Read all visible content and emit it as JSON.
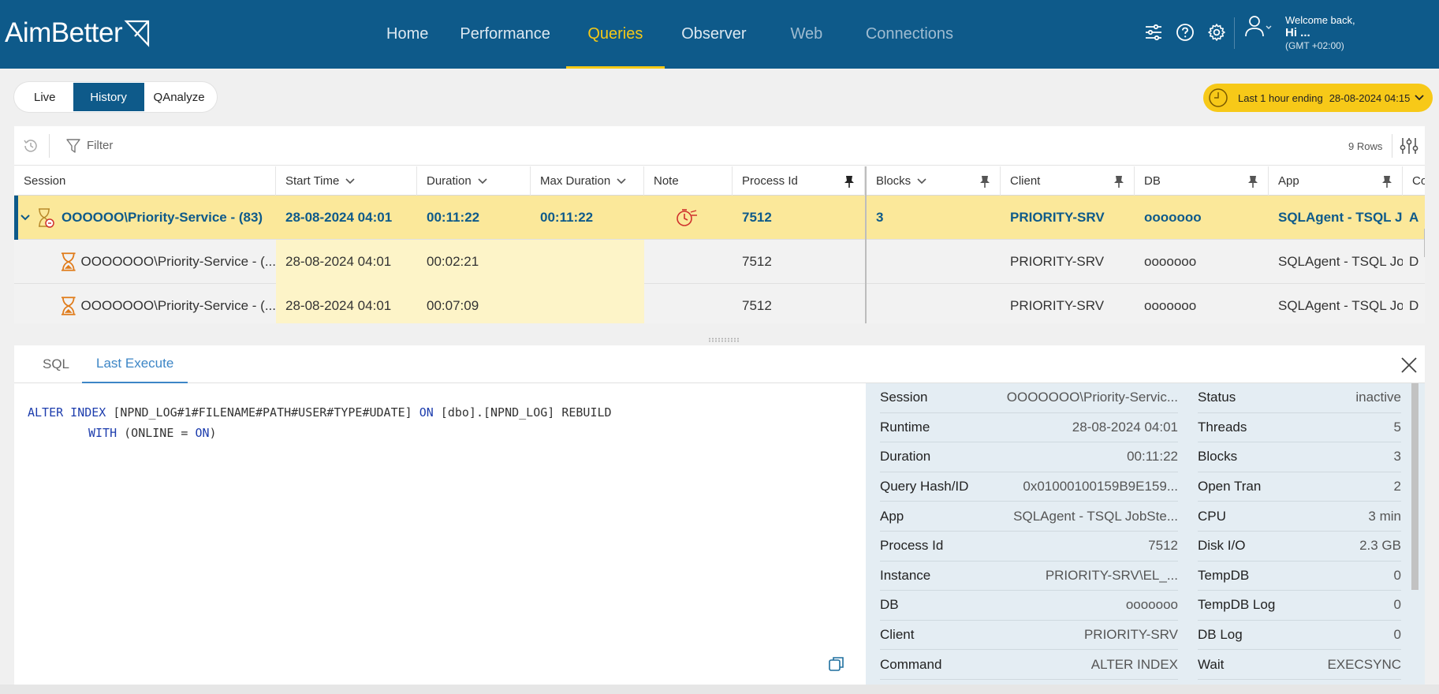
{
  "brand": {
    "name": "AimBetter"
  },
  "nav": [
    "Home",
    "Performance",
    "Queries",
    "Observer",
    "Web",
    "Connections"
  ],
  "user": {
    "welcome": "Welcome back,",
    "greeting": "Hi ...",
    "timezone": "(GMT +02:00)"
  },
  "mode_tabs": [
    "Live",
    "History",
    "QAnalyze"
  ],
  "time_range": {
    "label": "Last 1 hour ending",
    "value": "28-08-2024 04:15"
  },
  "toolbar": {
    "filter": "Filter",
    "rows": "9 Rows"
  },
  "columns": [
    "Session",
    "Start Time",
    "Duration",
    "Max Duration",
    "Note",
    "Process Id",
    "Blocks",
    "Client",
    "DB",
    "App",
    "Con"
  ],
  "rows": [
    {
      "session": "OOOOOO\\Priority-Service - (83)",
      "start": "28-08-2024 04:01",
      "duration": "00:11:22",
      "max_duration": "00:11:22",
      "process_id": "7512",
      "blocks": "3",
      "client": "PRIORITY-SRV",
      "db": "ooooooo",
      "app": "SQLAgent - TSQL Jo",
      "con": "A"
    },
    {
      "session": "OOOOOOO\\Priority-Service - (...",
      "start": "28-08-2024 04:01",
      "duration": "00:02:21",
      "max_duration": "",
      "process_id": "7512",
      "blocks": "",
      "client": "PRIORITY-SRV",
      "db": "ooooooo",
      "app": "SQLAgent - TSQL Jo",
      "con": "D"
    },
    {
      "session": "OOOOOOO\\Priority-Service - (...",
      "start": "28-08-2024 04:01",
      "duration": "00:07:09",
      "max_duration": "",
      "process_id": "7512",
      "blocks": "",
      "client": "PRIORITY-SRV",
      "db": "ooooooo",
      "app": "SQLAgent - TSQL Jo",
      "con": "D"
    }
  ],
  "detail_tabs": [
    "SQL",
    "Last Execute"
  ],
  "sql": {
    "line1": {
      "k1": "ALTER INDEX",
      "t1": " [NPND_LOG#1#FILENAME#PATH#USER#TYPE#UDATE] ",
      "k2": "ON",
      "t2": " [dbo].[NPND_LOG] REBUILD"
    },
    "line2": {
      "k1": "WITH",
      "t1": " (ONLINE = ",
      "k2": "ON",
      "t2": ")"
    }
  },
  "info_left": [
    {
      "k": "Session",
      "v": "OOOOOOO\\Priority-Servic..."
    },
    {
      "k": "Runtime",
      "v": "28-08-2024 04:01"
    },
    {
      "k": "Duration",
      "v": "00:11:22"
    },
    {
      "k": "Query Hash/ID",
      "v": "0x01000100159B9E159..."
    },
    {
      "k": "App",
      "v": "SQLAgent - TSQL JobSte..."
    },
    {
      "k": "Process Id",
      "v": "7512"
    },
    {
      "k": "Instance",
      "v": "PRIORITY-SRV\\EL_..."
    },
    {
      "k": "DB",
      "v": "ooooooo"
    },
    {
      "k": "Client",
      "v": "PRIORITY-SRV"
    },
    {
      "k": "Command",
      "v": "ALTER INDEX"
    }
  ],
  "info_right": [
    {
      "k": "Status",
      "v": "inactive"
    },
    {
      "k": "Threads",
      "v": "5"
    },
    {
      "k": "Blocks",
      "v": "3"
    },
    {
      "k": "Open Tran",
      "v": "2"
    },
    {
      "k": "CPU",
      "v": "3 min"
    },
    {
      "k": "Disk I/O",
      "v": "2.3 GB"
    },
    {
      "k": "TempDB",
      "v": "0"
    },
    {
      "k": "TempDB Log",
      "v": "0"
    },
    {
      "k": "DB Log",
      "v": "0"
    },
    {
      "k": "Wait",
      "v": "EXECSYNC"
    }
  ],
  "colors": {
    "primary": "#0e5a8a",
    "accent": "#f5c917",
    "row_highlight": "#fbe89a",
    "link": "#3d86c6"
  }
}
